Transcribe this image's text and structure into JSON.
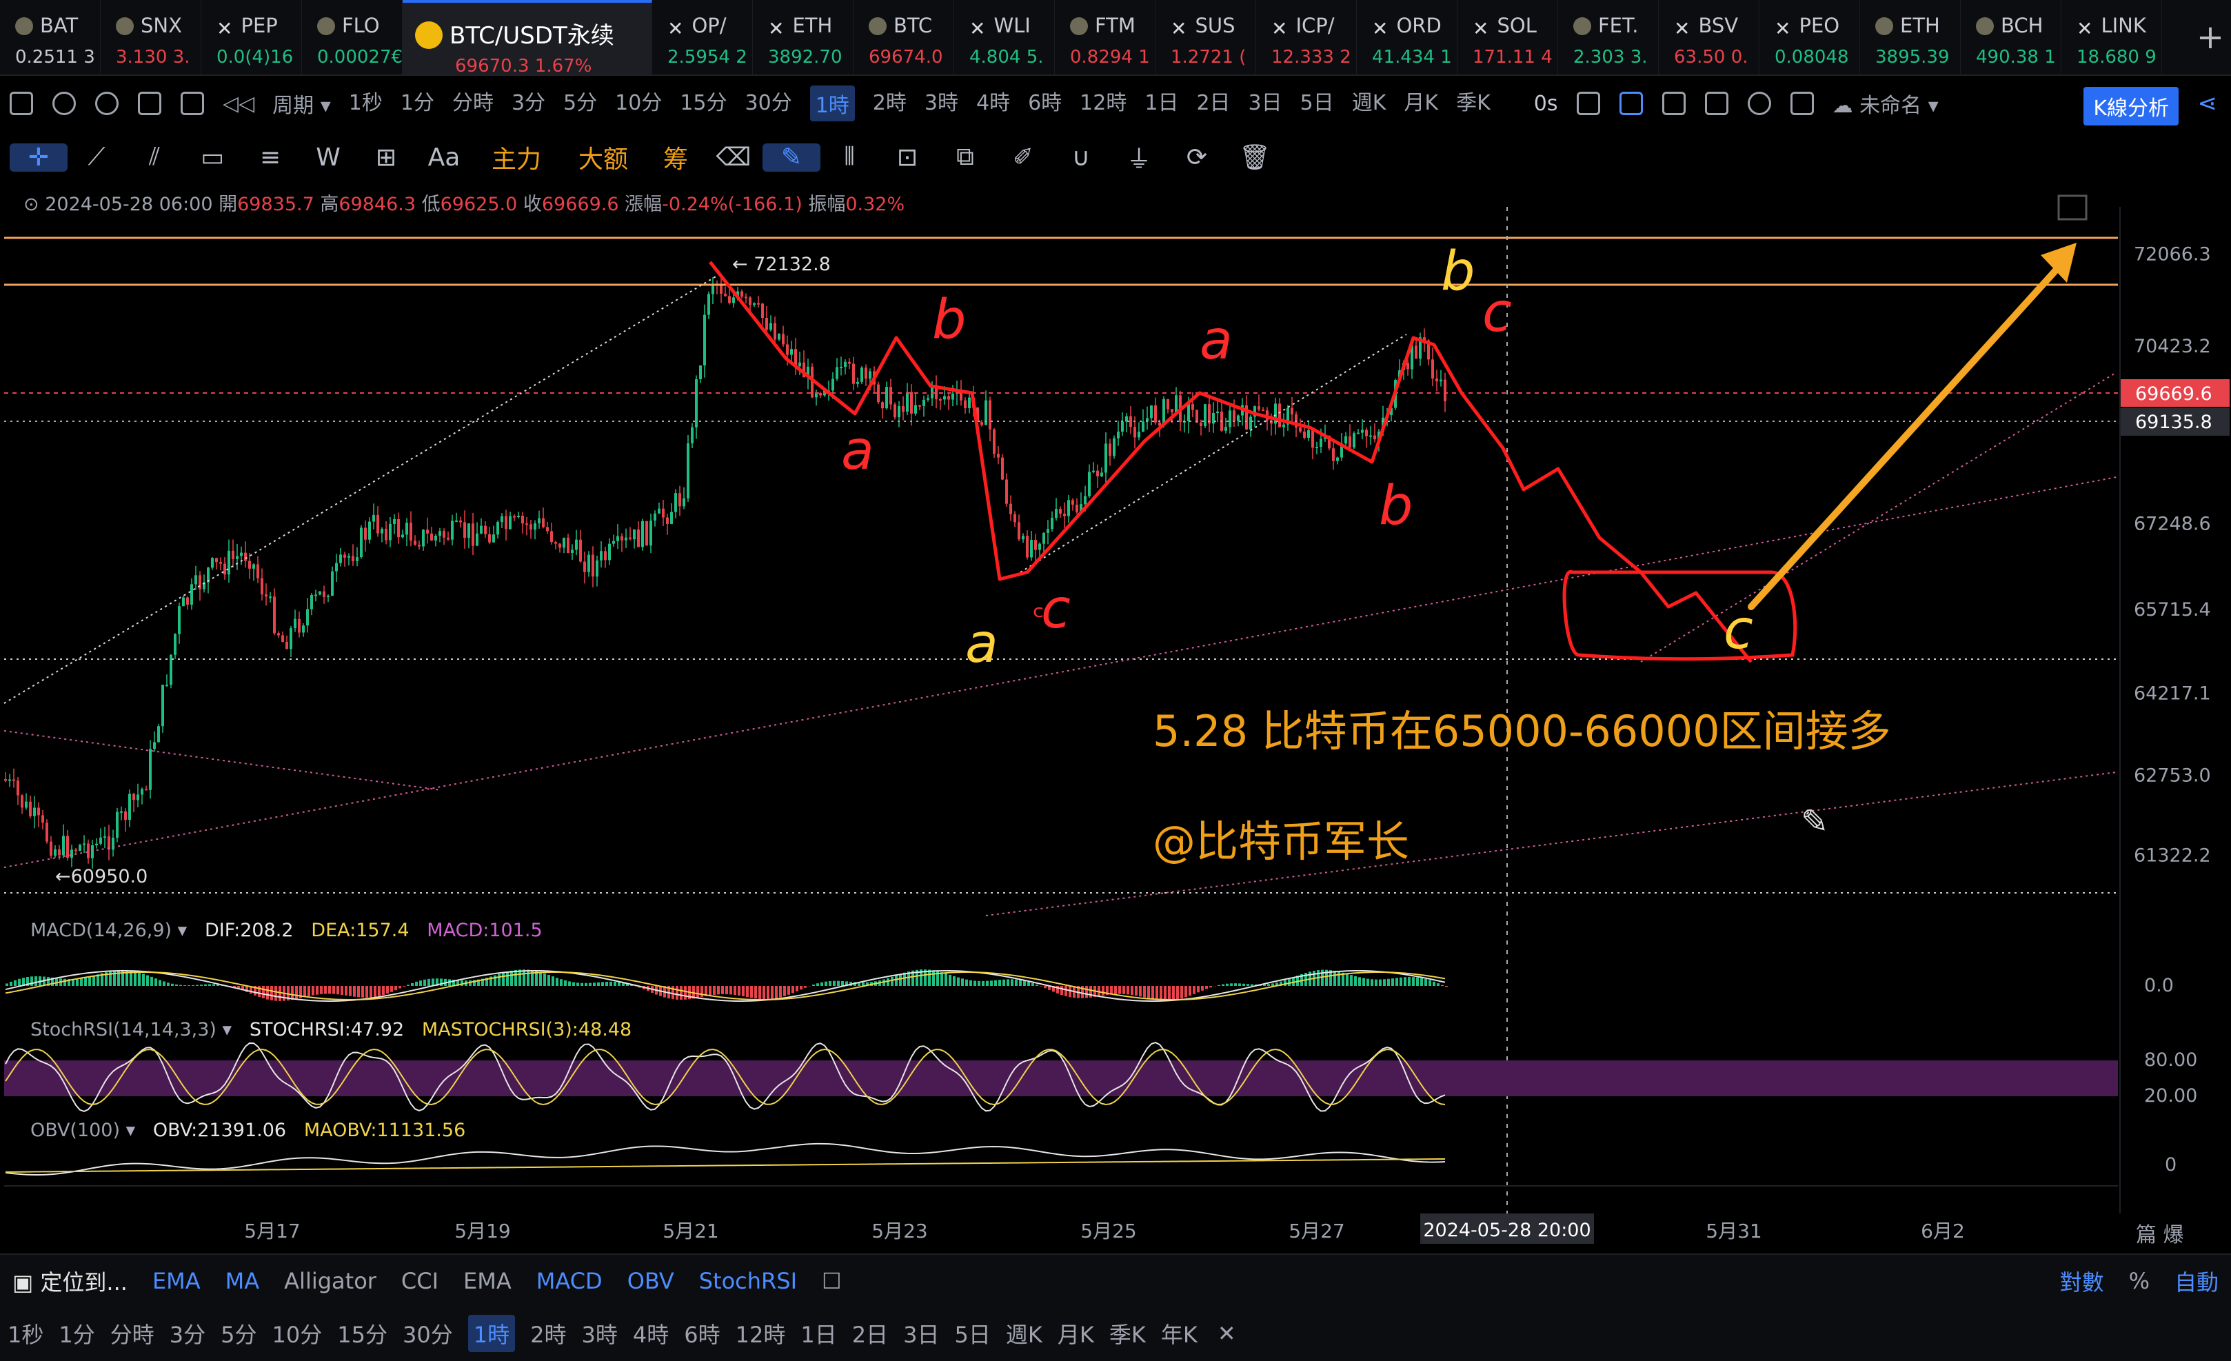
{
  "tickers": [
    {
      "name": "BAT",
      "value": "0.2511 3",
      "dir": "wt",
      "icon": "coin-icon"
    },
    {
      "name": "SNX",
      "value": "3.130 3.",
      "dir": "dn",
      "icon": "coin-icon"
    },
    {
      "name": "PEP",
      "value": "0.0(4)16",
      "dir": "up",
      "icon": "perp-icon"
    },
    {
      "name": "FLO",
      "value": "0.00027€",
      "dir": "up",
      "icon": "coin-icon"
    },
    {
      "name": "OP/",
      "value": "2.5954 2",
      "dir": "up",
      "icon": "perp-icon"
    },
    {
      "name": "ETH",
      "value": "3892.70",
      "dir": "up",
      "icon": "perp-icon"
    },
    {
      "name": "BTC",
      "value": "69674.0",
      "dir": "dn",
      "icon": "coin-icon"
    },
    {
      "name": "WLI",
      "value": "4.804 5.",
      "dir": "up",
      "icon": "perp-icon"
    },
    {
      "name": "FTM",
      "value": "0.8294 1",
      "dir": "dn",
      "icon": "coin-icon"
    },
    {
      "name": "SUS",
      "value": "1.2721 (",
      "dir": "dn",
      "icon": "perp-icon"
    },
    {
      "name": "ICP/",
      "value": "12.333 2",
      "dir": "dn",
      "icon": "perp-icon"
    },
    {
      "name": "ORD",
      "value": "41.434 1",
      "dir": "up",
      "icon": "perp-icon"
    },
    {
      "name": "SOL",
      "value": "171.11 4",
      "dir": "dn",
      "icon": "perp-icon"
    },
    {
      "name": "FET.",
      "value": "2.303 3.",
      "dir": "up",
      "icon": "coin-icon"
    },
    {
      "name": "BSV",
      "value": "63.50 0.",
      "dir": "dn",
      "icon": "perp-icon"
    },
    {
      "name": "PEO",
      "value": "0.08048",
      "dir": "up",
      "icon": "perp-icon"
    },
    {
      "name": "ETH",
      "value": "3895.39",
      "dir": "up",
      "icon": "coin-icon"
    },
    {
      "name": "BCH",
      "value": "490.38 1",
      "dir": "up",
      "icon": "coin-icon"
    },
    {
      "name": "LINK",
      "value": "18.680 9",
      "dir": "up",
      "icon": "perp-icon"
    }
  ],
  "active_ticker": {
    "name": "BTC/USDT永续",
    "price": "69670.3",
    "change": "1.67%"
  },
  "toolbar": {
    "period_label": "周期",
    "intervals": [
      "1秒",
      "1分",
      "分時",
      "3分",
      "5分",
      "10分",
      "15分",
      "30分",
      "1時",
      "2時",
      "3時",
      "4時",
      "6時",
      "12時",
      "1日",
      "2日",
      "3日",
      "5日",
      "週K",
      "月K",
      "季K"
    ],
    "selected_interval": "1時",
    "countdown": "0s",
    "layout_name": "未命名",
    "kline_btn": "K線分析"
  },
  "drawing_tools": [
    "主力",
    "大额",
    "筹"
  ],
  "ohlc": {
    "date": "2024-05-28 06:00",
    "open_label": "開",
    "open": "69835.7",
    "high_label": "高",
    "high": "69846.3",
    "low_label": "低",
    "low": "69625.0",
    "close_label": "收",
    "close": "69669.6",
    "change_label": "漲幅",
    "change": "-0.24%(-166.1)",
    "amp_label": "振幅",
    "amp": "0.32%"
  },
  "chart_data": {
    "type": "candlestick",
    "y_ticks": [
      "72066.3",
      "70423.2",
      "67248.6",
      "65715.4",
      "64217.1",
      "62753.0",
      "61322.2"
    ],
    "x_ticks": [
      "5月17",
      "5月19",
      "5月21",
      "5月23",
      "5月25",
      "5月27",
      "5月31",
      "6月2"
    ],
    "crosshair_x_label": "2024-05-28 20:00",
    "last_price": "69669.6",
    "crosshair_price": "69135.8",
    "high_marker": "72132.8",
    "low_marker": "60950.0",
    "ylim": [
      60700,
      72900
    ],
    "wave_labels": [
      "b",
      "a",
      "a",
      "c",
      "b",
      "a",
      "b",
      "c",
      "c"
    ]
  },
  "annotation": {
    "text": "5.28 比特币在65000-66000区间接多",
    "author": "@比特币军长"
  },
  "indicators": {
    "macd": {
      "label": "MACD(14,26,9)",
      "dif": "DIF:208.2",
      "dea": "DEA:157.4",
      "macd": "MACD:101.5",
      "zero": "0.0"
    },
    "stochrsi": {
      "label": "StochRSI(14,14,3,3)",
      "v": "STOCHRSI:47.92",
      "ma": "MASTOCHRSI(3):48.48",
      "hi": "80.00",
      "lo": "20.00"
    },
    "obv": {
      "label": "OBV(100)",
      "v": "OBV:21391.06",
      "ma": "MAOBV:11131.56",
      "zero": "0"
    }
  },
  "bottom": {
    "locate": "定位到...",
    "indicators": [
      "EMA",
      "MA",
      "Alligator",
      "CCI",
      "EMA",
      "MACD",
      "OBV",
      "StochRSI"
    ],
    "right": [
      "對數",
      "%",
      "自動"
    ],
    "intervals": [
      "1秒",
      "1分",
      "分時",
      "3分",
      "5分",
      "10分",
      "15分",
      "30分",
      "1時",
      "2時",
      "3時",
      "4時",
      "6時",
      "12時",
      "1日",
      "2日",
      "3日",
      "5日",
      "週K",
      "月K",
      "季K",
      "年K"
    ],
    "selected": "1時"
  }
}
